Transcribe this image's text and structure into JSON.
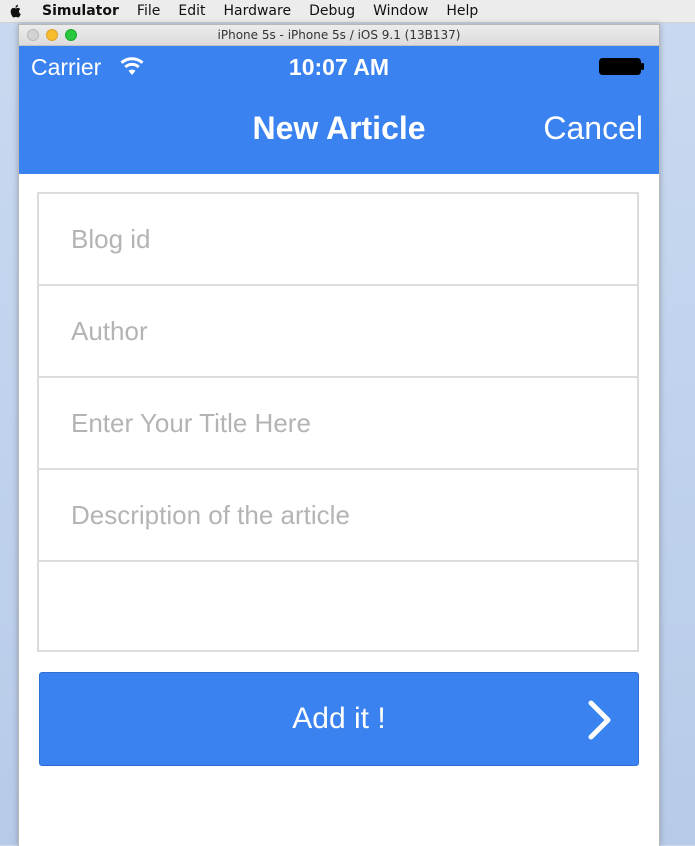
{
  "menubar": {
    "app_name": "Simulator",
    "items": [
      "File",
      "Edit",
      "Hardware",
      "Debug",
      "Window",
      "Help"
    ]
  },
  "window": {
    "title": "iPhone 5s - iPhone 5s / iOS 9.1 (13B137)"
  },
  "status_bar": {
    "carrier": "Carrier",
    "time": "10:07 AM"
  },
  "nav_bar": {
    "title": "New Article",
    "cancel_label": "Cancel"
  },
  "form": {
    "fields": [
      {
        "placeholder": "Blog id",
        "value": ""
      },
      {
        "placeholder": "Author",
        "value": ""
      },
      {
        "placeholder": "Enter Your Title Here",
        "value": ""
      },
      {
        "placeholder": "Description of the article",
        "value": ""
      },
      {
        "placeholder": "",
        "value": ""
      }
    ]
  },
  "submit": {
    "label": "Add it !"
  },
  "colors": {
    "accent": "#3a82f0",
    "placeholder": "#b4b4b4"
  },
  "icons": [
    "apple-icon",
    "wifi-icon",
    "battery-icon",
    "chevron-right-icon"
  ]
}
